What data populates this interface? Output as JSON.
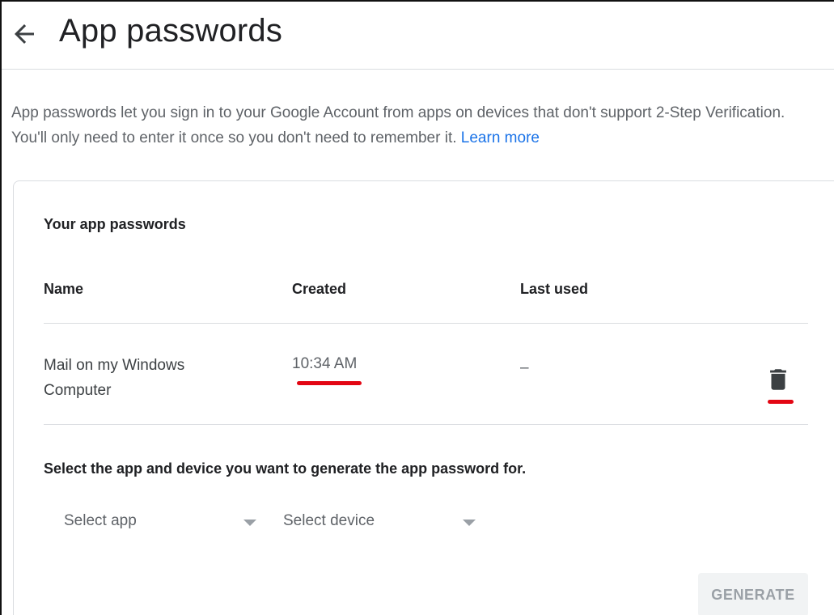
{
  "header": {
    "title": "App passwords",
    "back_icon": "arrow-back-icon"
  },
  "intro": {
    "text": "App passwords let you sign in to your Google Account from apps on devices that don't support 2-Step Verification. You'll only need to enter it once so you don't need to remember it.",
    "link_label": "Learn more"
  },
  "card": {
    "section_title": "Your app passwords",
    "columns": [
      "Name",
      "Created",
      "Last used"
    ],
    "rows": [
      {
        "name": "Mail on my Windows Computer",
        "created": "10:34 AM",
        "last_used": "–",
        "delete_icon": "trash-icon"
      }
    ],
    "select_prompt": "Select the app and device you want to generate the app password for.",
    "select_app_label": "Select app",
    "select_device_label": "Select device",
    "generate_label": "GENERATE"
  },
  "colors": {
    "link": "#1a73e8",
    "annotation_underline": "#e30613",
    "divider": "#dadce0"
  }
}
